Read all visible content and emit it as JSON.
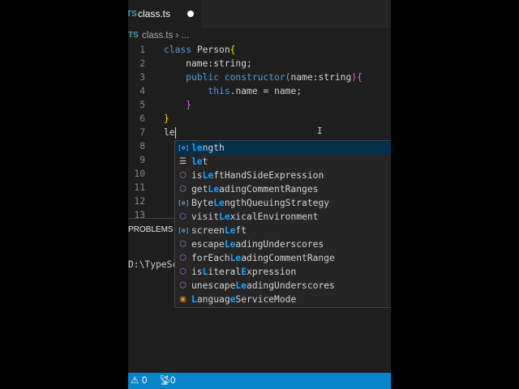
{
  "tab": {
    "lang_badge": "TS",
    "filename": "class.ts"
  },
  "breadcrumb": {
    "lang_badge": "TS",
    "file": "class.ts",
    "sep": " › ",
    "more": "..."
  },
  "code_lines": [
    {
      "n": "1",
      "tokens": [
        [
          "class ",
          "#569cd6"
        ],
        [
          "Person",
          "#d4d4d4"
        ],
        [
          "{",
          "#ffd700"
        ]
      ]
    },
    {
      "n": "2",
      "tokens": [
        [
          "    name:string;",
          "#d4d4d4"
        ]
      ]
    },
    {
      "n": "3",
      "tokens": [
        [
          "    ",
          "#d4d4d4"
        ],
        [
          "public ",
          "#569cd6"
        ],
        [
          "constructor",
          "#569cd6"
        ],
        [
          "(",
          "#da70d6"
        ],
        [
          "name:string",
          "#d4d4d4"
        ],
        [
          ")",
          "#da70d6"
        ],
        [
          "{",
          "#da70d6"
        ]
      ]
    },
    {
      "n": "4",
      "tokens": [
        [
          "        ",
          "#d4d4d4"
        ],
        [
          "this",
          "#569cd6"
        ],
        [
          ".name = name;",
          "#d4d4d4"
        ]
      ]
    },
    {
      "n": "5",
      "tokens": [
        [
          "    ",
          "#d4d4d4"
        ],
        [
          "}",
          "#da70d6"
        ]
      ]
    },
    {
      "n": "6",
      "tokens": [
        [
          "}",
          "#ffd700"
        ]
      ]
    },
    {
      "n": "7",
      "tokens": [
        [
          "le",
          "#d4d4d4"
        ]
      ]
    },
    {
      "n": "8",
      "tokens": []
    },
    {
      "n": "9",
      "tokens": []
    },
    {
      "n": "10",
      "tokens": []
    },
    {
      "n": "11",
      "tokens": []
    },
    {
      "n": "12",
      "tokens": []
    },
    {
      "n": "13",
      "tokens": []
    }
  ],
  "suggestions": [
    {
      "icon": "variable",
      "segments": [
        "",
        "le",
        "ngth"
      ]
    },
    {
      "icon": "keyword",
      "segments": [
        "",
        "le",
        "t"
      ]
    },
    {
      "icon": "method",
      "segments": [
        "is",
        "Le",
        "ftHandSideExpression"
      ]
    },
    {
      "icon": "method",
      "segments": [
        "get",
        "Le",
        "adingCommentRanges"
      ]
    },
    {
      "icon": "variable",
      "segments": [
        "Byte",
        "Le",
        "ngthQueuingStrategy"
      ]
    },
    {
      "icon": "method",
      "segments": [
        "visit",
        "Le",
        "xicalEnvironment"
      ]
    },
    {
      "icon": "variable",
      "segments": [
        "screen",
        "Le",
        "ft"
      ]
    },
    {
      "icon": "method",
      "segments": [
        "escape",
        "Le",
        "adingUnderscores"
      ]
    },
    {
      "icon": "method",
      "segments": [
        "forEach",
        "Le",
        "adingCommentRange"
      ]
    },
    {
      "icon": "method",
      "segments": [
        "is",
        "L",
        "iteral",
        "E",
        "xpression"
      ]
    },
    {
      "icon": "method",
      "segments": [
        "unescape",
        "Le",
        "adingUnderscores"
      ]
    },
    {
      "icon": "enum",
      "segments": [
        "",
        "L",
        "anguag",
        "e",
        "ServiceMode"
      ]
    }
  ],
  "panel": {
    "title": "PROBLEMS",
    "terminal_text": "D:\\TypeSc"
  },
  "status": {
    "warnings": "0",
    "ports": "0"
  },
  "colors": {
    "accent": "#0a84c8",
    "match": "#18a3ff",
    "method": "#b180d7",
    "variable": "#75beff",
    "enum": "#ee9d28"
  }
}
